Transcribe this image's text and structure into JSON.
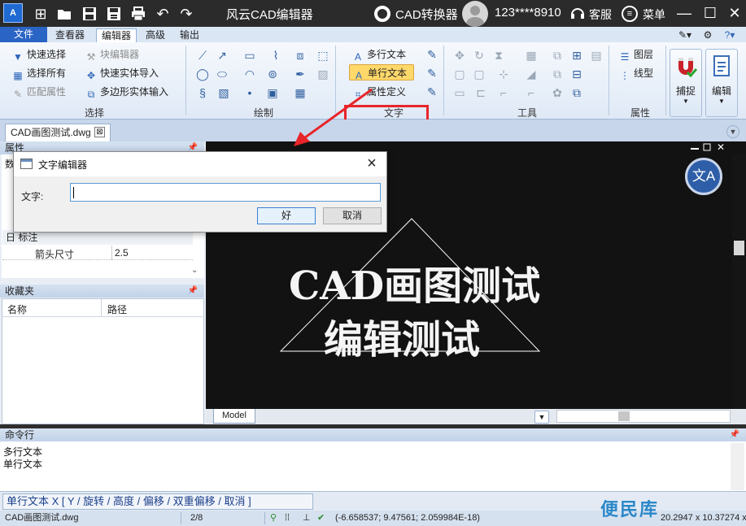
{
  "titlebar": {
    "app_icon_text": "A",
    "title": "风云CAD编辑器",
    "converter_label": "CAD转换器",
    "user_label": "123****8910",
    "service_label": "客服",
    "menu_label": "菜单",
    "menu_icon": "≡",
    "new_icon": "⊞",
    "open_icon": "folder-open-icon",
    "save_icon": "floppy-icon",
    "saveas_icon": "floppy-pen-icon",
    "print_icon": "printer-icon",
    "undo_icon": "↶",
    "redo_icon": "↷",
    "minimize": "—",
    "maximize": "☐",
    "close": "✕"
  },
  "ribbon_tabs": [
    "文件",
    "查看器",
    "编辑器",
    "高级",
    "输出"
  ],
  "ribbon": {
    "select": {
      "label": "选择",
      "quick_select": "快速选择",
      "block_editor": "块编辑器",
      "select_all": "选择所有",
      "quick_entity_import": "快速实体导入",
      "match_props": "匹配属性",
      "polygon_entity_input": "多边形实体输入"
    },
    "draw": {
      "label": "绘制"
    },
    "text": {
      "label": "文字",
      "multiline": "多行文本",
      "single_line": "单行文本",
      "attr_def": "属性定义"
    },
    "tools": {
      "label": "工具"
    },
    "props": {
      "label": "属性",
      "layers": "图层",
      "linetype": "线型"
    },
    "snap": "捕捉",
    "edit": "编辑"
  },
  "doc_tab": {
    "name": "CAD画图测试.dwg",
    "close": "⊠"
  },
  "props_panel": {
    "title": "属性",
    "partial": "数",
    "section": "日 标注",
    "row_label": "箭头尺寸",
    "row_value": "2.5"
  },
  "favs_panel": {
    "title": "收藏夹",
    "col_name": "名称",
    "col_path": "路径"
  },
  "canvas": {
    "text_line1": "CAD画图测试",
    "text_line2": "编辑测试",
    "model_tab": "Model",
    "translate_icon": "文A",
    "bg_color": "#121212"
  },
  "cmd": {
    "title": "命令行",
    "lines": [
      "多行文本",
      "单行文本"
    ],
    "prompt": "单行文本 X [ Y / 旋转 / 高度 / 偏移 / 双重偏移 / 取消 ]"
  },
  "status": {
    "file": "CAD画图测试.dwg",
    "page": "2/8",
    "coords": "(-6.658537; 9.47561; 2.059984E-18)",
    "size": "20.2947 x 10.37274 x 0"
  },
  "watermark": "便民库",
  "dialog": {
    "title": "文字编辑器",
    "label": "文字:",
    "input_value": "",
    "ok": "好",
    "cancel": "取消"
  },
  "colors": {
    "highlight": "#e8252a",
    "accent": "#2a64c5",
    "title_bg": "#2b2b2b"
  }
}
